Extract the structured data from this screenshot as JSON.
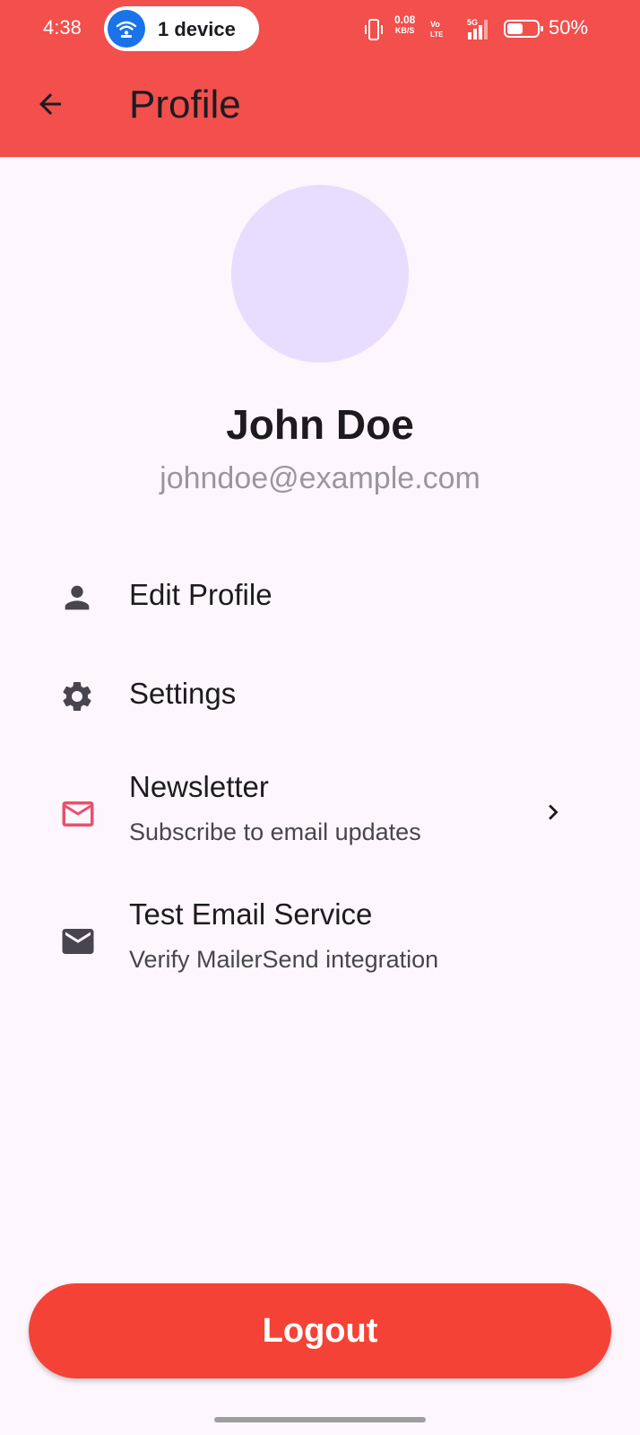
{
  "status_bar": {
    "time": "4:38",
    "device_pill_label": "1 device",
    "net_speed_value": "0.08",
    "net_speed_unit": "KB/S",
    "battery_percent": "50%",
    "icons": [
      "wifi-hotspot-icon",
      "vibrate-icon",
      "volte-icon",
      "signal-5g-icon",
      "battery-icon"
    ]
  },
  "app_bar": {
    "title": "Profile",
    "back_icon": "arrow-back-icon"
  },
  "profile": {
    "name": "John Doe",
    "email": "johndoe@example.com"
  },
  "menu": {
    "items": [
      {
        "title": "Edit Profile",
        "icon": "person-icon"
      },
      {
        "title": "Settings",
        "icon": "gear-icon"
      },
      {
        "title": "Newsletter",
        "subtitle": "Subscribe to email updates",
        "icon": "mail-outline-icon",
        "trailing_icon": "chevron-right-icon"
      },
      {
        "title": "Test Email Service",
        "subtitle": "Verify MailerSend integration",
        "icon": "mail-filled-icon"
      }
    ]
  },
  "logout": {
    "label": "Logout"
  },
  "colors": {
    "header": "#f24f4d",
    "background": "#fdf7fd",
    "avatar": "#e9ddff",
    "logout": "#f44336",
    "newsletter_icon": "#e8526b"
  }
}
